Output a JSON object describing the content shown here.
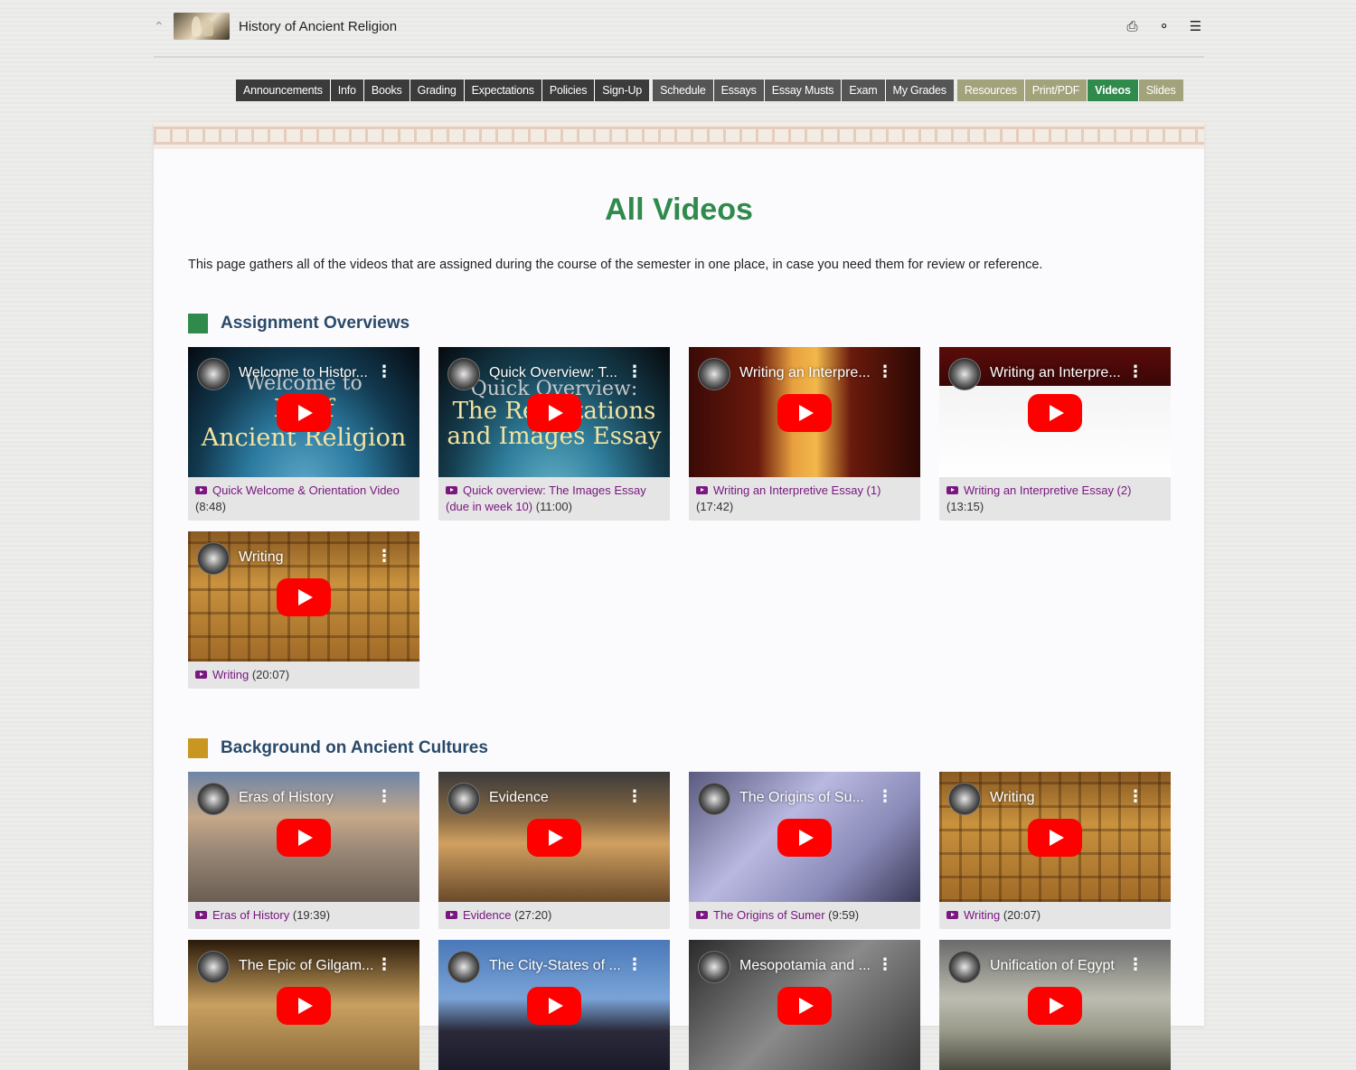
{
  "site": {
    "title": "History of Ancient Religion"
  },
  "top_icons": [
    "print-icon",
    "globe-icon",
    "menu-icon"
  ],
  "nav": {
    "group1": [
      "Announcements",
      "Info",
      "Books",
      "Grading",
      "Expectations",
      "Policies",
      "Sign-Up"
    ],
    "group2": [
      "Schedule",
      "Essays",
      "Essay Musts",
      "Exam",
      "My Grades"
    ],
    "group3": [
      "Resources",
      "Print/PDF",
      "Videos",
      "Slides"
    ],
    "active": "Videos"
  },
  "page": {
    "title": "All Videos",
    "intro": "This page gathers all of the videos that are assigned during the course of the semester in one place, in case you need them for review or reference."
  },
  "colors": {
    "accent_green": "#2f8a4c",
    "section_gold": "#c9961f",
    "link_purple": "#7a1780",
    "heading_blue": "#2a4a6a"
  },
  "sections": [
    {
      "heading": "Assignment Overviews",
      "color": "#2f8a4c",
      "videos": [
        {
          "thumb_title": "Welcome to Histor...",
          "overlay": [
            "Welcome to",
            "Hi        of",
            "Ancient Religion"
          ],
          "link": "Quick Welcome & Orientation Video",
          "duration": "(8:48)"
        },
        {
          "thumb_title": "Quick Overview: T...",
          "overlay": [
            "Quick Overview:",
            "The Rep        ntations",
            "and Images Essay"
          ],
          "link": "Quick overview: The Images Essay (due in week 10)",
          "duration": "(11:00)"
        },
        {
          "thumb_title": "Writing an Interpre...",
          "overlay": [],
          "link": "Writing an Interpretive Essay (1)",
          "duration": "(17:42)"
        },
        {
          "thumb_title": "Writing an Interpre...",
          "overlay": [],
          "link": "Writing an Interpretive Essay (2)",
          "duration": "(13:15)"
        },
        {
          "thumb_title": "Writing",
          "overlay": [],
          "link": "Writing",
          "duration": "(20:07)"
        }
      ]
    },
    {
      "heading": "Background on Ancient Cultures",
      "color": "#c9961f",
      "videos": [
        {
          "thumb_title": "Eras of History",
          "link": "Eras of History",
          "duration": "(19:39)"
        },
        {
          "thumb_title": "Evidence",
          "link": "Evidence",
          "duration": "(27:20)"
        },
        {
          "thumb_title": "The Origins of Su...",
          "link": "The Origins of Sumer",
          "duration": "(9:59)"
        },
        {
          "thumb_title": "Writing",
          "link": "Writing",
          "duration": "(20:07)"
        },
        {
          "thumb_title": "The Epic of Gilgam..."
        },
        {
          "thumb_title": "The City-States of ..."
        },
        {
          "thumb_title": "Mesopotamia and ..."
        },
        {
          "thumb_title": "Unification of Egypt"
        }
      ]
    }
  ]
}
